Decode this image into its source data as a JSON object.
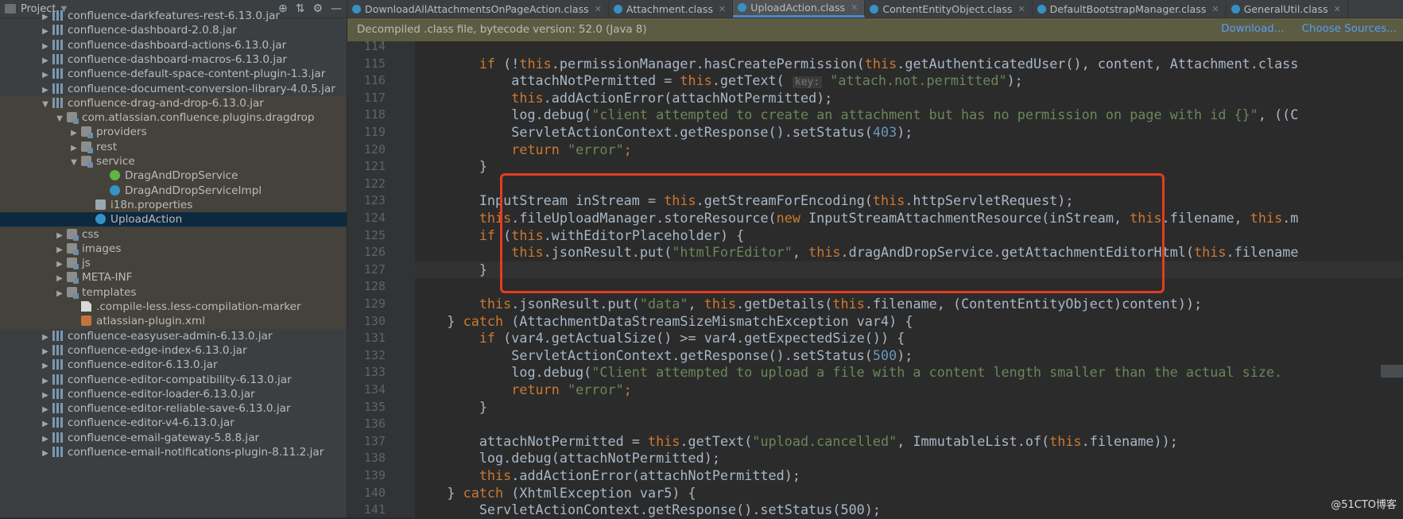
{
  "project_panel": {
    "title": "Project",
    "tree": [
      {
        "label": "confluence-darkfeatures-rest-6.13.0.jar",
        "indent": 3,
        "expand": "right",
        "icon": "jar-icon",
        "state": ""
      },
      {
        "label": "confluence-dashboard-2.0.8.jar",
        "indent": 3,
        "expand": "right",
        "icon": "jar-icon",
        "state": ""
      },
      {
        "label": "confluence-dashboard-actions-6.13.0.jar",
        "indent": 3,
        "expand": "right",
        "icon": "jar-icon",
        "state": ""
      },
      {
        "label": "confluence-dashboard-macros-6.13.0.jar",
        "indent": 3,
        "expand": "right",
        "icon": "jar-icon",
        "state": ""
      },
      {
        "label": "confluence-default-space-content-plugin-1.3.jar",
        "indent": 3,
        "expand": "right",
        "icon": "jar-icon",
        "state": ""
      },
      {
        "label": "confluence-document-conversion-library-4.0.5.jar",
        "indent": 3,
        "expand": "right",
        "icon": "jar-icon",
        "state": ""
      },
      {
        "label": "confluence-drag-and-drop-6.13.0.jar",
        "indent": 3,
        "expand": "down",
        "icon": "jar-icon",
        "state": "hl"
      },
      {
        "label": "com.atlassian.confluence.plugins.dragdrop",
        "indent": 4,
        "expand": "down",
        "icon": "package-icon",
        "state": "hl"
      },
      {
        "label": "providers",
        "indent": 5,
        "expand": "right",
        "icon": "package-icon",
        "state": "hl"
      },
      {
        "label": "rest",
        "indent": 5,
        "expand": "right",
        "icon": "package-icon",
        "state": "hl"
      },
      {
        "label": "service",
        "indent": 5,
        "expand": "down",
        "icon": "package-icon",
        "state": "hl"
      },
      {
        "label": "DragAndDropService",
        "indent": 7,
        "expand": "",
        "icon": "interface-icon",
        "state": "hl"
      },
      {
        "label": "DragAndDropServiceImpl",
        "indent": 7,
        "expand": "",
        "icon": "class-icon",
        "state": "hl"
      },
      {
        "label": "i18n.properties",
        "indent": 6,
        "expand": "",
        "icon": "properties-icon",
        "state": "hl"
      },
      {
        "label": "UploadAction",
        "indent": 6,
        "expand": "",
        "icon": "class-icon",
        "state": "sel"
      },
      {
        "label": "css",
        "indent": 4,
        "expand": "right",
        "icon": "package-icon",
        "state": "hl"
      },
      {
        "label": "images",
        "indent": 4,
        "expand": "right",
        "icon": "package-icon",
        "state": "hl"
      },
      {
        "label": "js",
        "indent": 4,
        "expand": "right",
        "icon": "package-icon",
        "state": "hl"
      },
      {
        "label": "META-INF",
        "indent": 4,
        "expand": "right",
        "icon": "package-icon",
        "state": "hl"
      },
      {
        "label": "templates",
        "indent": 4,
        "expand": "right",
        "icon": "package-icon",
        "state": "hl"
      },
      {
        "label": ".compile-less.less-compilation-marker",
        "indent": 5,
        "expand": "",
        "icon": "file-icon",
        "state": "hl"
      },
      {
        "label": "atlassian-plugin.xml",
        "indent": 5,
        "expand": "",
        "icon": "xml-icon",
        "state": "hl"
      },
      {
        "label": "confluence-easyuser-admin-6.13.0.jar",
        "indent": 3,
        "expand": "right",
        "icon": "jar-icon",
        "state": ""
      },
      {
        "label": "confluence-edge-index-6.13.0.jar",
        "indent": 3,
        "expand": "right",
        "icon": "jar-icon",
        "state": ""
      },
      {
        "label": "confluence-editor-6.13.0.jar",
        "indent": 3,
        "expand": "right",
        "icon": "jar-icon",
        "state": ""
      },
      {
        "label": "confluence-editor-compatibility-6.13.0.jar",
        "indent": 3,
        "expand": "right",
        "icon": "jar-icon",
        "state": ""
      },
      {
        "label": "confluence-editor-loader-6.13.0.jar",
        "indent": 3,
        "expand": "right",
        "icon": "jar-icon",
        "state": ""
      },
      {
        "label": "confluence-editor-reliable-save-6.13.0.jar",
        "indent": 3,
        "expand": "right",
        "icon": "jar-icon",
        "state": ""
      },
      {
        "label": "confluence-editor-v4-6.13.0.jar",
        "indent": 3,
        "expand": "right",
        "icon": "jar-icon",
        "state": ""
      },
      {
        "label": "confluence-email-gateway-5.8.8.jar",
        "indent": 3,
        "expand": "right",
        "icon": "jar-icon",
        "state": ""
      },
      {
        "label": "confluence-email-notifications-plugin-8.11.2.jar",
        "indent": 3,
        "expand": "right",
        "icon": "jar-icon",
        "state": ""
      }
    ]
  },
  "tabs": [
    {
      "label": "DownloadAllAttachmentsOnPageAction.class",
      "active": false
    },
    {
      "label": "Attachment.class",
      "active": false
    },
    {
      "label": "UploadAction.class",
      "active": true
    },
    {
      "label": "ContentEntityObject.class",
      "active": false
    },
    {
      "label": "DefaultBootstrapManager.class",
      "active": false
    },
    {
      "label": "GeneralUtil.class",
      "active": false
    }
  ],
  "banner": {
    "text": "Decompiled .class file, bytecode version: 52.0 (Java 8)",
    "download": "Download...",
    "choose_sources": "Choose Sources..."
  },
  "editor": {
    "lines": [
      {
        "n": 114,
        "t": []
      },
      {
        "n": 115,
        "t": [
          [
            "",
            "        "
          ],
          [
            "kw",
            "if"
          ],
          [
            "",
            " (!"
          ],
          [
            "kw",
            "this"
          ],
          [
            "",
            ".permissionManager.hasCreatePermission("
          ],
          [
            "kw",
            "this"
          ],
          [
            "",
            ".getAuthenticatedUser(), content, Attachment.class"
          ]
        ]
      },
      {
        "n": 116,
        "t": [
          [
            "",
            "            attachNotPermitted = "
          ],
          [
            "kw",
            "this"
          ],
          [
            "",
            ".getText( "
          ],
          [
            "hint",
            "key:"
          ],
          [
            "",
            " "
          ],
          [
            "str",
            "\"attach.not.permitted\""
          ],
          [
            "",
            ");"
          ]
        ]
      },
      {
        "n": 117,
        "t": [
          [
            "",
            "            "
          ],
          [
            "kw",
            "this"
          ],
          [
            "",
            ".addActionError(attachNotPermitted);"
          ]
        ]
      },
      {
        "n": 118,
        "t": [
          [
            "",
            "            log.debug("
          ],
          [
            "str",
            "\"client attempted to create an attachment but has no permission on page with id {}\""
          ],
          [
            "",
            ", ((C"
          ]
        ]
      },
      {
        "n": 119,
        "t": [
          [
            "",
            "            ServletActionContext.getResponse().setStatus("
          ],
          [
            "num",
            "403"
          ],
          [
            "",
            ");"
          ]
        ]
      },
      {
        "n": 120,
        "t": [
          [
            "",
            "            "
          ],
          [
            "kw",
            "return"
          ],
          [
            "",
            " "
          ],
          [
            "str",
            "\"error\""
          ],
          [
            "kw",
            ";"
          ]
        ]
      },
      {
        "n": 121,
        "t": [
          [
            "",
            "        }"
          ]
        ]
      },
      {
        "n": 122,
        "t": []
      },
      {
        "n": 123,
        "t": [
          [
            "",
            "        InputStream inStream = "
          ],
          [
            "kw",
            "this"
          ],
          [
            "",
            ".getStreamForEncoding("
          ],
          [
            "kw",
            "this"
          ],
          [
            "",
            ".httpServletRequest);"
          ]
        ]
      },
      {
        "n": 124,
        "t": [
          [
            "",
            "        "
          ],
          [
            "kw",
            "this"
          ],
          [
            "",
            ".fileUploadManager.storeResource("
          ],
          [
            "kw",
            "new"
          ],
          [
            "",
            " InputStreamAttachmentResource(inStream, "
          ],
          [
            "kw",
            "this"
          ],
          [
            "",
            ".filename, "
          ],
          [
            "kw",
            "this"
          ],
          [
            "",
            ".m"
          ]
        ]
      },
      {
        "n": 125,
        "t": [
          [
            "",
            "        "
          ],
          [
            "kw",
            "if"
          ],
          [
            "",
            " ("
          ],
          [
            "kw",
            "this"
          ],
          [
            "",
            ".withEditorPlaceholder) {"
          ]
        ]
      },
      {
        "n": 126,
        "t": [
          [
            "",
            "            "
          ],
          [
            "kw",
            "this"
          ],
          [
            "",
            ".jsonResult.put("
          ],
          [
            "str",
            "\"htmlForEditor\""
          ],
          [
            "",
            ", "
          ],
          [
            "kw",
            "this"
          ],
          [
            "",
            ".dragAndDropService.getAttachmentEditorHtml("
          ],
          [
            "kw",
            "this"
          ],
          [
            "",
            ".filename"
          ]
        ]
      },
      {
        "n": 127,
        "t": [
          [
            "",
            "        }"
          ]
        ],
        "caret": true
      },
      {
        "n": 128,
        "t": []
      },
      {
        "n": 129,
        "t": [
          [
            "",
            "        "
          ],
          [
            "kw",
            "this"
          ],
          [
            "",
            ".jsonResult.put("
          ],
          [
            "str",
            "\"data\""
          ],
          [
            "",
            ", "
          ],
          [
            "kw",
            "this"
          ],
          [
            "",
            ".getDetails("
          ],
          [
            "kw",
            "this"
          ],
          [
            "",
            ".filename, (ContentEntityObject)content));"
          ]
        ]
      },
      {
        "n": 130,
        "t": [
          [
            "",
            "    } "
          ],
          [
            "kw",
            "catch"
          ],
          [
            "",
            " (AttachmentDataStreamSizeMismatchException var4) {"
          ]
        ]
      },
      {
        "n": 131,
        "t": [
          [
            "",
            "        "
          ],
          [
            "kw",
            "if"
          ],
          [
            "",
            " (var4.getActualSize() >= var4.getExpectedSize()) {"
          ]
        ]
      },
      {
        "n": 132,
        "t": [
          [
            "",
            "            ServletActionContext.getResponse().setStatus("
          ],
          [
            "num",
            "500"
          ],
          [
            "",
            ");"
          ]
        ]
      },
      {
        "n": 133,
        "t": [
          [
            "",
            "            log.debug("
          ],
          [
            "str",
            "\"Client attempted to upload a file with a content length smaller than the actual size."
          ]
        ]
      },
      {
        "n": 134,
        "t": [
          [
            "",
            "            "
          ],
          [
            "kw",
            "return"
          ],
          [
            "",
            " "
          ],
          [
            "str",
            "\"error\""
          ],
          [
            "kw",
            ";"
          ]
        ]
      },
      {
        "n": 135,
        "t": [
          [
            "",
            "        }"
          ]
        ]
      },
      {
        "n": 136,
        "t": []
      },
      {
        "n": 137,
        "t": [
          [
            "",
            "        attachNotPermitted = "
          ],
          [
            "kw",
            "this"
          ],
          [
            "",
            ".getText("
          ],
          [
            "str",
            "\"upload.cancelled\""
          ],
          [
            "",
            ", ImmutableList.of("
          ],
          [
            "kw",
            "this"
          ],
          [
            "",
            ".filename));"
          ]
        ]
      },
      {
        "n": 138,
        "t": [
          [
            "",
            "        log.debug(attachNotPermitted);"
          ]
        ]
      },
      {
        "n": 139,
        "t": [
          [
            "",
            "        "
          ],
          [
            "kw",
            "this"
          ],
          [
            "",
            ".addActionError(attachNotPermitted);"
          ]
        ]
      },
      {
        "n": 140,
        "t": [
          [
            "",
            "    } "
          ],
          [
            "kw",
            "catch"
          ],
          [
            "",
            " (XhtmlException var5) {"
          ]
        ]
      },
      {
        "n": 141,
        "t": [
          [
            "",
            "        ServletActionContext.getResponse().setStatus(500);"
          ]
        ]
      }
    ]
  },
  "watermark": "@51CTO博客"
}
